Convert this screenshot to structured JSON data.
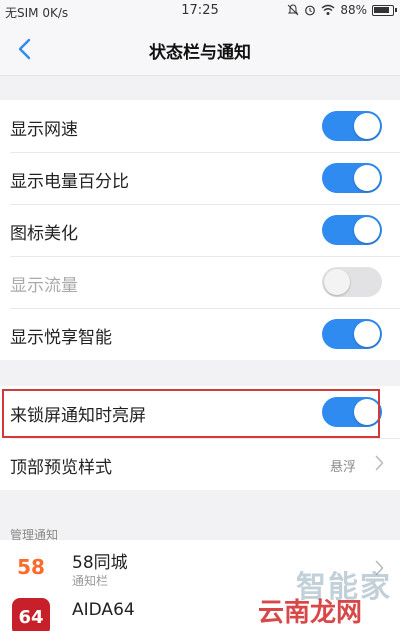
{
  "status_bar": {
    "carrier": "无SIM 0K/s",
    "time": "17:25",
    "battery": "88%"
  },
  "nav": {
    "title": "状态栏与通知"
  },
  "toggles": [
    {
      "label": "显示网速",
      "on": true,
      "disabled": false
    },
    {
      "label": "显示电量百分比",
      "on": true,
      "disabled": false
    },
    {
      "label": "图标美化",
      "on": true,
      "disabled": false
    },
    {
      "label": "显示流量",
      "on": false,
      "disabled": true
    },
    {
      "label": "显示悦享智能",
      "on": true,
      "disabled": false
    }
  ],
  "lock_screen": {
    "label": "来锁屏通知时亮屏",
    "on": true
  },
  "top_preview": {
    "label": "顶部预览样式",
    "value": "悬浮"
  },
  "manage_section": {
    "header": "管理通知",
    "apps": [
      {
        "icon_text": "58",
        "name": "58同城",
        "sub": "通知栏"
      },
      {
        "icon_text": "64",
        "name": "AIDA64",
        "sub": ""
      }
    ]
  },
  "watermark": {
    "text1": "智能家",
    "text2": "云南龙网"
  },
  "colors": {
    "accent": "#2f8bf0",
    "highlight": "#d23a3a"
  }
}
